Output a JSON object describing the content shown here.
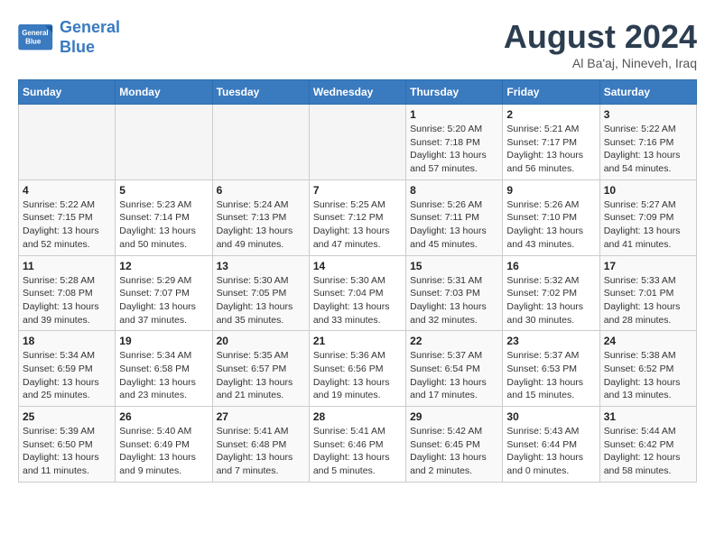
{
  "header": {
    "logo_line1": "General",
    "logo_line2": "Blue",
    "month": "August 2024",
    "location": "Al Ba'aj, Nineveh, Iraq"
  },
  "days_of_week": [
    "Sunday",
    "Monday",
    "Tuesday",
    "Wednesday",
    "Thursday",
    "Friday",
    "Saturday"
  ],
  "weeks": [
    [
      {
        "day": "",
        "info": ""
      },
      {
        "day": "",
        "info": ""
      },
      {
        "day": "",
        "info": ""
      },
      {
        "day": "",
        "info": ""
      },
      {
        "day": "1",
        "info": "Sunrise: 5:20 AM\nSunset: 7:18 PM\nDaylight: 13 hours and 57 minutes."
      },
      {
        "day": "2",
        "info": "Sunrise: 5:21 AM\nSunset: 7:17 PM\nDaylight: 13 hours and 56 minutes."
      },
      {
        "day": "3",
        "info": "Sunrise: 5:22 AM\nSunset: 7:16 PM\nDaylight: 13 hours and 54 minutes."
      }
    ],
    [
      {
        "day": "4",
        "info": "Sunrise: 5:22 AM\nSunset: 7:15 PM\nDaylight: 13 hours and 52 minutes."
      },
      {
        "day": "5",
        "info": "Sunrise: 5:23 AM\nSunset: 7:14 PM\nDaylight: 13 hours and 50 minutes."
      },
      {
        "day": "6",
        "info": "Sunrise: 5:24 AM\nSunset: 7:13 PM\nDaylight: 13 hours and 49 minutes."
      },
      {
        "day": "7",
        "info": "Sunrise: 5:25 AM\nSunset: 7:12 PM\nDaylight: 13 hours and 47 minutes."
      },
      {
        "day": "8",
        "info": "Sunrise: 5:26 AM\nSunset: 7:11 PM\nDaylight: 13 hours and 45 minutes."
      },
      {
        "day": "9",
        "info": "Sunrise: 5:26 AM\nSunset: 7:10 PM\nDaylight: 13 hours and 43 minutes."
      },
      {
        "day": "10",
        "info": "Sunrise: 5:27 AM\nSunset: 7:09 PM\nDaylight: 13 hours and 41 minutes."
      }
    ],
    [
      {
        "day": "11",
        "info": "Sunrise: 5:28 AM\nSunset: 7:08 PM\nDaylight: 13 hours and 39 minutes."
      },
      {
        "day": "12",
        "info": "Sunrise: 5:29 AM\nSunset: 7:07 PM\nDaylight: 13 hours and 37 minutes."
      },
      {
        "day": "13",
        "info": "Sunrise: 5:30 AM\nSunset: 7:05 PM\nDaylight: 13 hours and 35 minutes."
      },
      {
        "day": "14",
        "info": "Sunrise: 5:30 AM\nSunset: 7:04 PM\nDaylight: 13 hours and 33 minutes."
      },
      {
        "day": "15",
        "info": "Sunrise: 5:31 AM\nSunset: 7:03 PM\nDaylight: 13 hours and 32 minutes."
      },
      {
        "day": "16",
        "info": "Sunrise: 5:32 AM\nSunset: 7:02 PM\nDaylight: 13 hours and 30 minutes."
      },
      {
        "day": "17",
        "info": "Sunrise: 5:33 AM\nSunset: 7:01 PM\nDaylight: 13 hours and 28 minutes."
      }
    ],
    [
      {
        "day": "18",
        "info": "Sunrise: 5:34 AM\nSunset: 6:59 PM\nDaylight: 13 hours and 25 minutes."
      },
      {
        "day": "19",
        "info": "Sunrise: 5:34 AM\nSunset: 6:58 PM\nDaylight: 13 hours and 23 minutes."
      },
      {
        "day": "20",
        "info": "Sunrise: 5:35 AM\nSunset: 6:57 PM\nDaylight: 13 hours and 21 minutes."
      },
      {
        "day": "21",
        "info": "Sunrise: 5:36 AM\nSunset: 6:56 PM\nDaylight: 13 hours and 19 minutes."
      },
      {
        "day": "22",
        "info": "Sunrise: 5:37 AM\nSunset: 6:54 PM\nDaylight: 13 hours and 17 minutes."
      },
      {
        "day": "23",
        "info": "Sunrise: 5:37 AM\nSunset: 6:53 PM\nDaylight: 13 hours and 15 minutes."
      },
      {
        "day": "24",
        "info": "Sunrise: 5:38 AM\nSunset: 6:52 PM\nDaylight: 13 hours and 13 minutes."
      }
    ],
    [
      {
        "day": "25",
        "info": "Sunrise: 5:39 AM\nSunset: 6:50 PM\nDaylight: 13 hours and 11 minutes."
      },
      {
        "day": "26",
        "info": "Sunrise: 5:40 AM\nSunset: 6:49 PM\nDaylight: 13 hours and 9 minutes."
      },
      {
        "day": "27",
        "info": "Sunrise: 5:41 AM\nSunset: 6:48 PM\nDaylight: 13 hours and 7 minutes."
      },
      {
        "day": "28",
        "info": "Sunrise: 5:41 AM\nSunset: 6:46 PM\nDaylight: 13 hours and 5 minutes."
      },
      {
        "day": "29",
        "info": "Sunrise: 5:42 AM\nSunset: 6:45 PM\nDaylight: 13 hours and 2 minutes."
      },
      {
        "day": "30",
        "info": "Sunrise: 5:43 AM\nSunset: 6:44 PM\nDaylight: 13 hours and 0 minutes."
      },
      {
        "day": "31",
        "info": "Sunrise: 5:44 AM\nSunset: 6:42 PM\nDaylight: 12 hours and 58 minutes."
      }
    ]
  ]
}
